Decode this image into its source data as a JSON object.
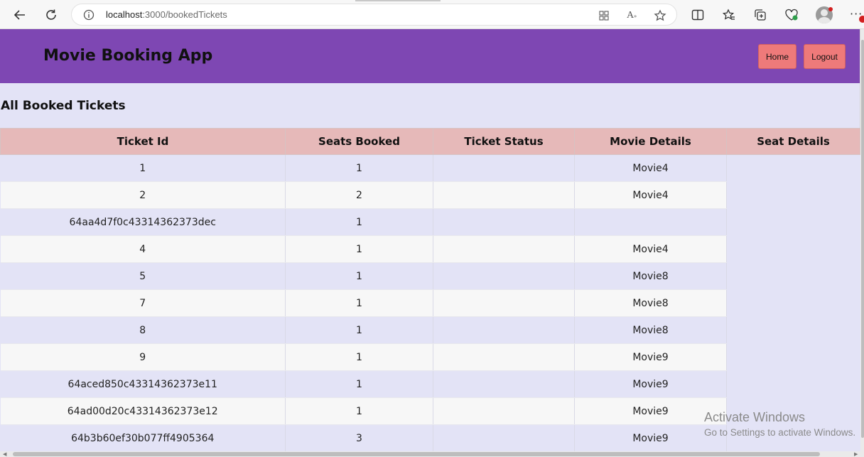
{
  "browser": {
    "url_host": "localhost",
    "url_path": ":3000/bookedTickets",
    "icons": [
      "back-arrow-icon",
      "refresh-icon",
      "info-icon",
      "app-grid-icon",
      "read-aloud-icon",
      "favorite-star-icon",
      "split-screen-icon",
      "favorites-icon",
      "collections-icon",
      "browser-essentials-icon",
      "profile-icon",
      "more-icon"
    ]
  },
  "header": {
    "title": "Movie Booking App",
    "home_label": "Home",
    "logout_label": "Logout"
  },
  "main": {
    "section_title": "All Booked Tickets",
    "columns": [
      "Ticket Id",
      "Seats Booked",
      "Ticket Status",
      "Movie Details",
      "Seat Details"
    ],
    "rows": [
      {
        "id": "1",
        "seats": "1",
        "status": "",
        "movie": "Movie4"
      },
      {
        "id": "2",
        "seats": "2",
        "status": "",
        "movie": "Movie4"
      },
      {
        "id": "64aa4d7f0c43314362373dec",
        "seats": "1",
        "status": "",
        "movie": ""
      },
      {
        "id": "4",
        "seats": "1",
        "status": "",
        "movie": "Movie4"
      },
      {
        "id": "5",
        "seats": "1",
        "status": "",
        "movie": "Movie8"
      },
      {
        "id": "7",
        "seats": "1",
        "status": "",
        "movie": "Movie8"
      },
      {
        "id": "8",
        "seats": "1",
        "status": "",
        "movie": "Movie8"
      },
      {
        "id": "9",
        "seats": "1",
        "status": "",
        "movie": "Movie9"
      },
      {
        "id": "64aced850c43314362373e11",
        "seats": "1",
        "status": "",
        "movie": "Movie9"
      },
      {
        "id": "64ad00d20c43314362373e12",
        "seats": "1",
        "status": "",
        "movie": "Movie9"
      },
      {
        "id": "64b3b60ef30b077ff4905364",
        "seats": "3",
        "status": "",
        "movie": "Movie9"
      }
    ]
  },
  "watermark": {
    "line1": "Activate Windows",
    "line2": "Go to Settings to activate Windows."
  },
  "colors": {
    "header_bg": "#7e47b3",
    "button_bg": "#ee7a7a",
    "table_header_bg": "#e6b9b9",
    "page_bg": "#e3e3f6"
  }
}
